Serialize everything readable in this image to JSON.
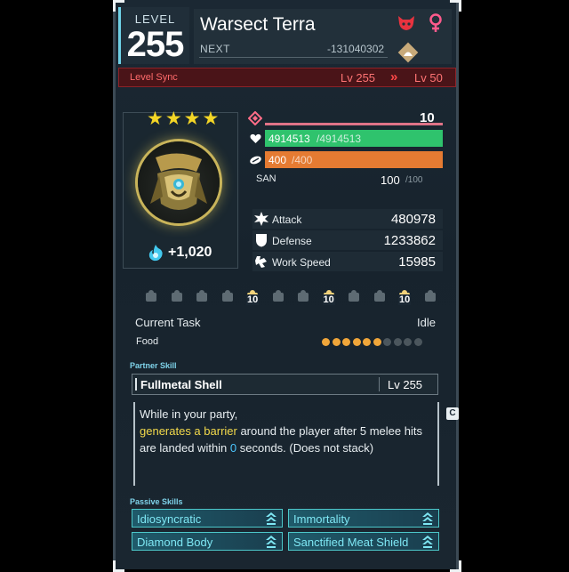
{
  "header": {
    "level_label": "LEVEL",
    "level": "255",
    "name": "Warsect Terra",
    "next_label": "NEXT",
    "next_value": "-131040302",
    "element_icon": "dark-element-icon",
    "gender_icon": "female-icon",
    "colors": {
      "accent": "#6fd1e6",
      "element": "#e8333f"
    }
  },
  "level_sync": {
    "label": "Level Sync",
    "from": "Lv 255",
    "arrow": "»",
    "to": "Lv 50"
  },
  "portrait": {
    "stars": "★★★★",
    "soul_value": "+1,020"
  },
  "stats": {
    "rank": {
      "value": "10",
      "fill": 1.0
    },
    "hp": {
      "current": "4914513",
      "max": "/4914513",
      "fill": 1.0,
      "color": "#2fc36d"
    },
    "stamina": {
      "current": "400",
      "max": "/400",
      "fill": 1.0,
      "color": "#e57b32"
    },
    "san": {
      "label": "SAN",
      "current": "100",
      "max": "/100"
    },
    "attack": {
      "label": "Attack",
      "value": "480978"
    },
    "defense": {
      "label": "Defense",
      "value": "1233862"
    },
    "work_speed": {
      "label": "Work Speed",
      "value": "15985"
    }
  },
  "work": {
    "suitabilities": [
      {
        "icon": "kindling-icon",
        "level": ""
      },
      {
        "icon": "watering-icon",
        "level": ""
      },
      {
        "icon": "planting-icon",
        "level": ""
      },
      {
        "icon": "electricity-icon",
        "level": ""
      },
      {
        "icon": "handiwork-icon",
        "level": "10"
      },
      {
        "icon": "gathering-icon",
        "level": ""
      },
      {
        "icon": "lumbering-icon",
        "level": ""
      },
      {
        "icon": "mining-icon",
        "level": "10"
      },
      {
        "icon": "medicine-icon",
        "level": ""
      },
      {
        "icon": "cooling-icon",
        "level": ""
      },
      {
        "icon": "transporting-icon",
        "level": "10"
      },
      {
        "icon": "farming-icon",
        "level": ""
      }
    ],
    "current_task_label": "Current Task",
    "current_task_value": "Idle",
    "food_label": "Food",
    "food_filled": 6,
    "food_total": 10
  },
  "partner_skill": {
    "section_label": "Partner Skill",
    "name": "Fullmetal Shell",
    "level": "Lv  255",
    "desc_line1": "While in your party,",
    "desc_highlight": "generates a barrier",
    "desc_mid": " around the player after 5 melee hits are landed within ",
    "desc_number": "0",
    "desc_end": " seconds. (Does not stack)",
    "button": "C"
  },
  "passive_skills": {
    "section_label": "Passive Skills",
    "items": [
      {
        "name": "Idiosyncratic"
      },
      {
        "name": "Immortality"
      },
      {
        "name": "Diamond Body"
      },
      {
        "name": "Sanctified Meat Shield"
      }
    ]
  }
}
